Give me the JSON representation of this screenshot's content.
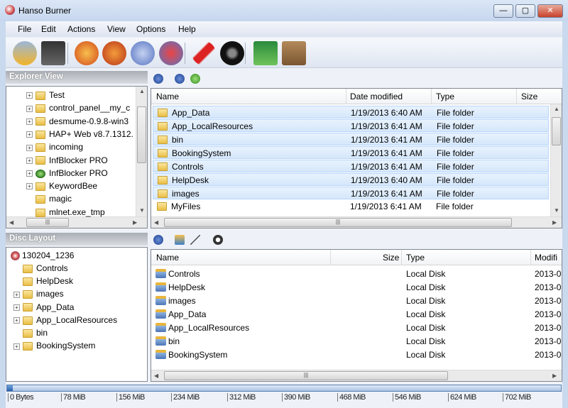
{
  "window": {
    "title": "Hanso Burner",
    "minimize": "—",
    "maximize": "▢",
    "close": "✕"
  },
  "menu": [
    "File",
    "Edit",
    "Actions",
    "View",
    "Options",
    "Help"
  ],
  "toolbar": [
    "open-project-icon",
    "save-icon",
    "burn-disc-icon",
    "burn-disc-fast-icon",
    "copy-disc-icon",
    "erase-disc-icon",
    "edit-icon",
    "disc-info-icon",
    "update-icon",
    "exit-icon"
  ],
  "explorer": {
    "title": "Explorer View",
    "tree": [
      {
        "label": "Test",
        "expand": true
      },
      {
        "label": "control_panel__my_c",
        "expand": true
      },
      {
        "label": "desmume-0.9.8-win3",
        "expand": true
      },
      {
        "label": "HAP+ Web v8.7.1312.",
        "expand": true
      },
      {
        "label": "incoming",
        "expand": true
      },
      {
        "label": "InfBlocker PRO",
        "expand": true
      },
      {
        "label": "InfBlocker PRO",
        "expand": true,
        "icon": "green-arrow-icon"
      },
      {
        "label": "KeywordBee",
        "expand": true
      },
      {
        "label": "magic",
        "expand": false
      },
      {
        "label": "mlnet.exe_tmp",
        "expand": false
      }
    ],
    "columns": [
      "Name",
      "Date modified",
      "Type",
      "Size"
    ],
    "rows": [
      [
        "App_Data",
        "1/19/2013 6:40 AM",
        "File folder"
      ],
      [
        "App_LocalResources",
        "1/19/2013 6:41 AM",
        "File folder"
      ],
      [
        "bin",
        "1/19/2013 6:41 AM",
        "File folder"
      ],
      [
        "BookingSystem",
        "1/19/2013 6:41 AM",
        "File folder"
      ],
      [
        "Controls",
        "1/19/2013 6:41 AM",
        "File folder"
      ],
      [
        "HelpDesk",
        "1/19/2013 6:40 AM",
        "File folder"
      ],
      [
        "images",
        "1/19/2013 6:41 AM",
        "File folder"
      ],
      [
        "MyFiles",
        "1/19/2013 6:41 AM",
        "File folder"
      ]
    ],
    "selected_rows": 7
  },
  "disc": {
    "title": "Disc Layout",
    "root": "130204_1236",
    "tree": [
      {
        "label": "Controls",
        "expand": false
      },
      {
        "label": "HelpDesk",
        "expand": false
      },
      {
        "label": "images",
        "expand": true
      },
      {
        "label": "App_Data",
        "expand": true
      },
      {
        "label": "App_LocalResources",
        "expand": true
      },
      {
        "label": "bin",
        "expand": false
      },
      {
        "label": "BookingSystem",
        "expand": true
      }
    ],
    "columns": [
      "Name",
      "Size",
      "Type",
      "Modifi"
    ],
    "rows": [
      [
        "Controls",
        "",
        "Local Disk",
        "2013-0"
      ],
      [
        "HelpDesk",
        "",
        "Local Disk",
        "2013-0"
      ],
      [
        "images",
        "",
        "Local Disk",
        "2013-0"
      ],
      [
        "App_Data",
        "",
        "Local Disk",
        "2013-0"
      ],
      [
        "App_LocalResources",
        "",
        "Local Disk",
        "2013-0"
      ],
      [
        "bin",
        "",
        "Local Disk",
        "2013-0"
      ],
      [
        "BookingSystem",
        "",
        "Local Disk",
        "2013-0"
      ]
    ]
  },
  "capacity": {
    "used_percent": 1,
    "scale": [
      "0 Bytes",
      "78 MiB",
      "156 MiB",
      "234 MiB",
      "312 MiB",
      "390 MiB",
      "468 MiB",
      "546 MiB",
      "624 MiB",
      "702 MiB"
    ]
  },
  "colors": {
    "accent": "#3c7fc9",
    "selection": "#d5e7fb"
  }
}
